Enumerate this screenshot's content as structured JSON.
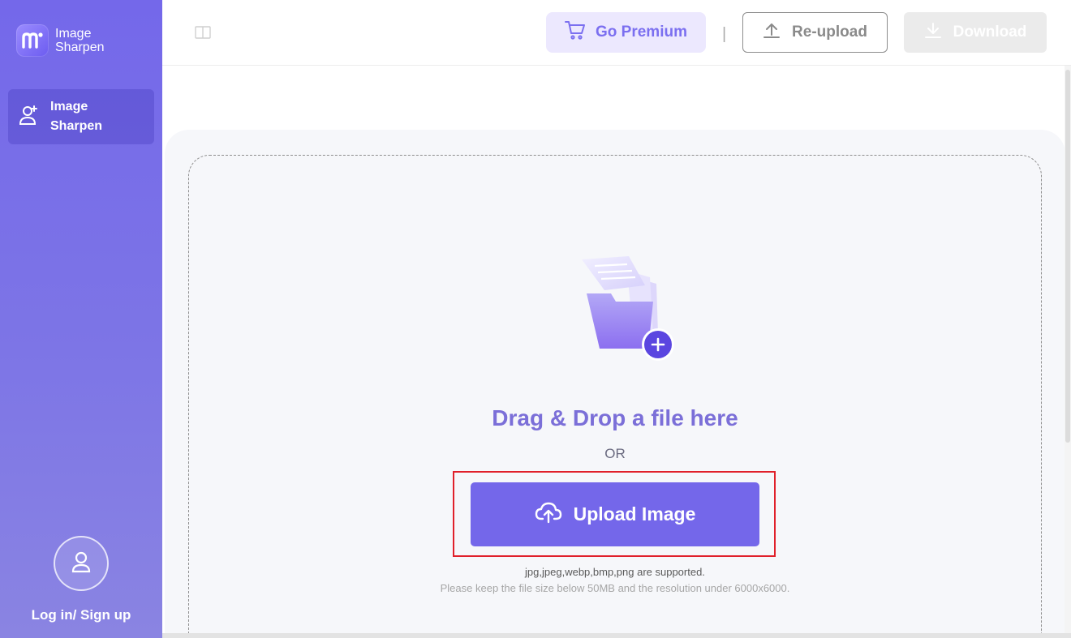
{
  "sidebar": {
    "brand": {
      "name": "Image Sharpen",
      "logo_icon": "m-logo-icon"
    },
    "items": [
      {
        "label": "Image Sharpen",
        "icon": "user-plus-icon",
        "active": true
      }
    ],
    "account": {
      "label": "Log in/ Sign up",
      "icon": "user-icon"
    }
  },
  "topbar": {
    "premium_label": "Go Premium",
    "separator": "|",
    "reupload_label": "Re-upload",
    "download_label": "Download"
  },
  "upload": {
    "title": "Drag & Drop a file here",
    "or_text": "OR",
    "button_label": "Upload Image",
    "formats_text": "jpg,jpeg,webp,bmp,png are supported.",
    "limits_text": "Please keep the file size below 50MB and the resolution under 6000x6000."
  },
  "colors": {
    "accent": "#7467ea",
    "sidebar_bg": "#7468ea",
    "title_text": "#7b6fd8",
    "highlight_border": "#e0202a"
  }
}
